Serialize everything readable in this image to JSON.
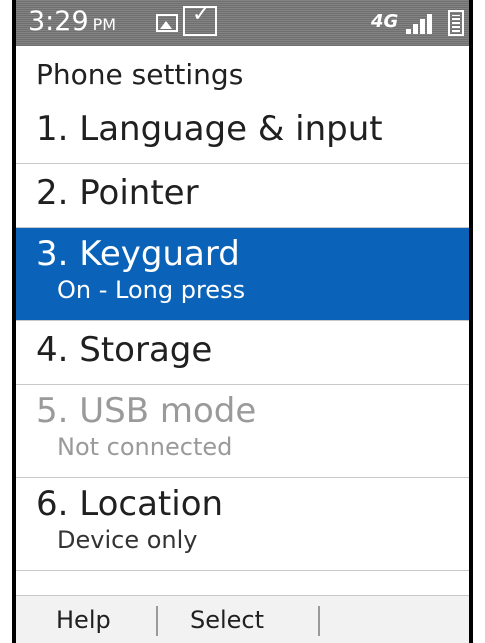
{
  "status_bar": {
    "time": "3:29",
    "ampm": "PM",
    "network_label": "4G"
  },
  "header": {
    "title": "Phone settings"
  },
  "menu": {
    "items": [
      {
        "label": "1. Language & input",
        "sub": ""
      },
      {
        "label": "2. Pointer",
        "sub": ""
      },
      {
        "label": "3. Keyguard",
        "sub": "On - Long press",
        "selected": true
      },
      {
        "label": "4. Storage",
        "sub": ""
      },
      {
        "label": "5. USB mode",
        "sub": "Not connected",
        "disabled": true
      },
      {
        "label": "6. Location",
        "sub": "Device only"
      }
    ]
  },
  "softkeys": {
    "left": "Help",
    "center": "Select",
    "right": ""
  },
  "colors": {
    "selection": "#0a63b8",
    "disabled_text": "#9a9a9a"
  }
}
